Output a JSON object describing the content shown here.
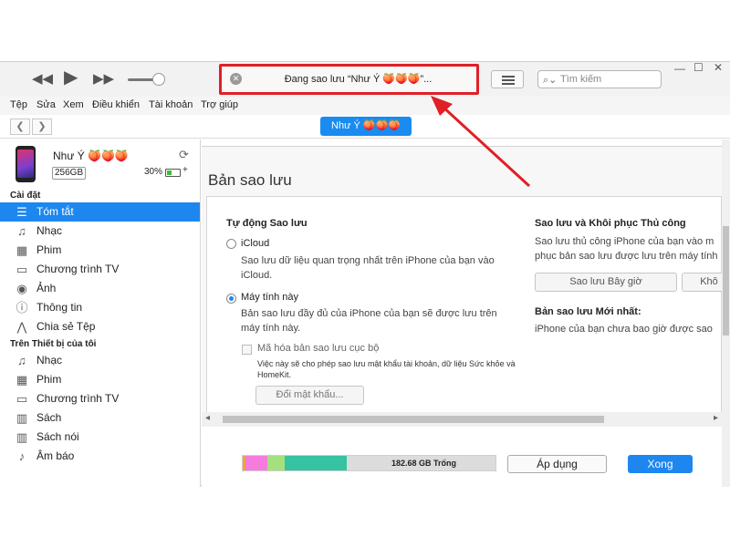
{
  "toolbar": {
    "status_text": "Đang sao lưu “Như Ý 🍑🍑🍑”...",
    "search_placeholder": "Tìm kiếm",
    "rewind_icon": "rewind-icon",
    "play_icon": "play-icon",
    "forward_icon": "fast-forward-icon",
    "volume_level": 0.85
  },
  "menu": [
    "Tệp",
    "Sửa",
    "Xem",
    "Điều khiển",
    "Tài khoản",
    "Trợ giúp"
  ],
  "device_pill": "Như Ý 🍑🍑🍑",
  "device": {
    "name": "Như Ý 🍑🍑🍑",
    "capacity": "256GB",
    "battery": "30%"
  },
  "sidebar": {
    "settings_header": "Cài đặt",
    "settings_items": [
      {
        "label": "Tóm tắt",
        "icon": "summary-icon",
        "glyph": "☰"
      },
      {
        "label": "Nhạc",
        "icon": "music-icon",
        "glyph": "♫"
      },
      {
        "label": "Phim",
        "icon": "film-icon",
        "glyph": "▦"
      },
      {
        "label": "Chương trình TV",
        "icon": "tv-icon",
        "glyph": "▭"
      },
      {
        "label": "Ảnh",
        "icon": "camera-icon",
        "glyph": "◉"
      },
      {
        "label": "Thông tin",
        "icon": "info-icon",
        "glyph": "ⓘ"
      },
      {
        "label": "Chia sẻ Tệp",
        "icon": "file-sharing-icon",
        "glyph": "⋀"
      }
    ],
    "device_header": "Trên Thiết bị của tôi",
    "device_items": [
      {
        "label": "Nhạc",
        "icon": "music-icon",
        "glyph": "♫"
      },
      {
        "label": "Phim",
        "icon": "film-icon",
        "glyph": "▦"
      },
      {
        "label": "Chương trình TV",
        "icon": "tv-icon",
        "glyph": "▭"
      },
      {
        "label": "Sách",
        "icon": "book-icon",
        "glyph": "▥"
      },
      {
        "label": "Sách nói",
        "icon": "audiobook-icon",
        "glyph": "▥"
      },
      {
        "label": "Âm báo",
        "icon": "bell-icon",
        "glyph": "♪"
      }
    ]
  },
  "main": {
    "section_title": "Bản sao lưu",
    "auto_backup": {
      "title": "Tự động Sao lưu",
      "icloud_label": "iCloud",
      "icloud_desc_1": "Sao lưu dữ liệu quan trọng nhất trên iPhone của bạn vào",
      "icloud_desc_2": "iCloud.",
      "computer_label": "Máy tính này",
      "computer_desc_1": "Bản sao lưu đầy đủ của iPhone của bạn sẽ được lưu trên",
      "computer_desc_2": "máy tính này.",
      "encrypt_label": "Mã hóa bản sao lưu cục bộ",
      "encrypt_desc_1": "Việc này sẽ cho phép sao lưu mật khẩu tài khoản, dữ liệu Sức khỏe và",
      "encrypt_desc_2": "HomeKit.",
      "change_password": "Đổi mật khẩu..."
    },
    "manual_backup": {
      "title": "Sao lưu và Khôi phục Thủ công",
      "desc_1": "Sao lưu thủ công iPhone của bạn vào m",
      "desc_2": "phục bản sao lưu được lưu trên máy tính",
      "backup_now": "Sao lưu Bây giờ",
      "restore": "Khô",
      "latest_title": "Bản sao lưu Mới nhất:",
      "latest_desc": "iPhone của bạn chưa bao giờ được sao"
    }
  },
  "bottom": {
    "free_space": "182.68 GB Trống",
    "apply": "Áp dụng",
    "done": "Xong",
    "storage_segments": [
      {
        "color": "#f0a23c",
        "fraction": 0.01
      },
      {
        "color": "#f57bdc",
        "fraction": 0.085
      },
      {
        "color": "#a4e07e",
        "fraction": 0.07
      },
      {
        "color": "#35c3a1",
        "fraction": 0.245
      }
    ]
  },
  "colors": {
    "accent": "#1d87ef",
    "highlight": "#e01f26"
  }
}
